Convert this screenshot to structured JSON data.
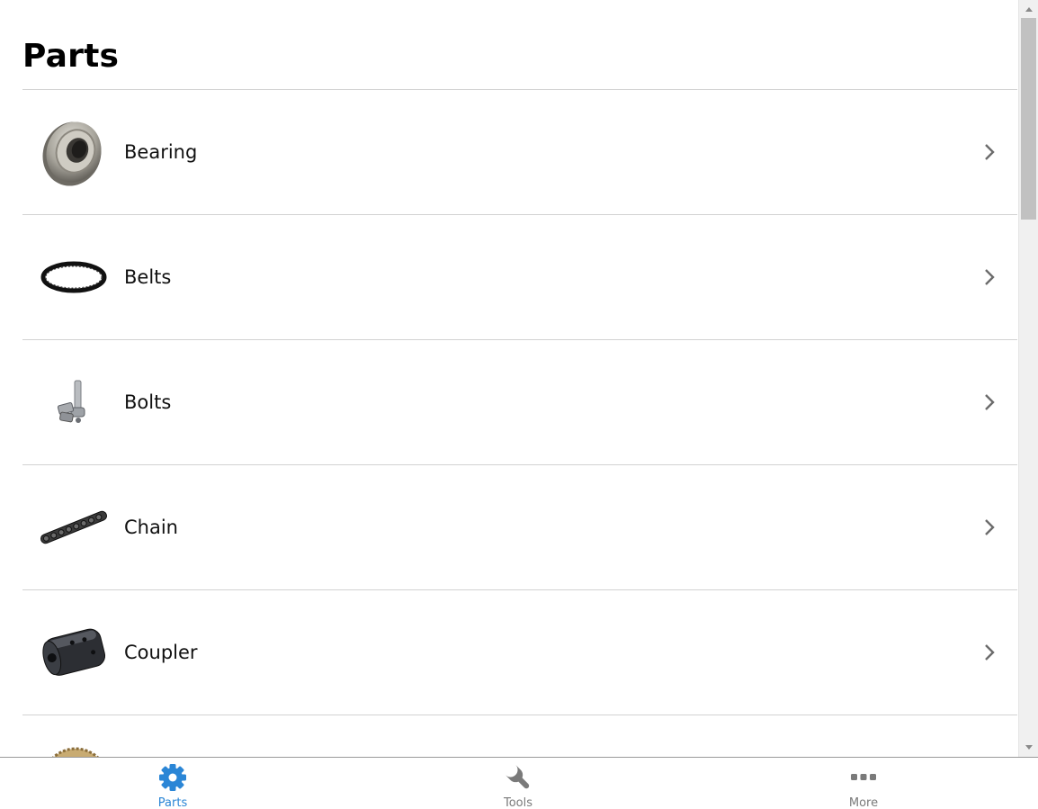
{
  "page": {
    "title": "Parts"
  },
  "parts": [
    {
      "label": "Bearing",
      "image": "bearing-image"
    },
    {
      "label": "Belts",
      "image": "belt-image"
    },
    {
      "label": "Bolts",
      "image": "bolts-image"
    },
    {
      "label": "Chain",
      "image": "chain-image"
    },
    {
      "label": "Coupler",
      "image": "coupler-image"
    },
    {
      "label": "",
      "image": "gear-image"
    }
  ],
  "tabs": [
    {
      "label": "Parts",
      "icon": "gear-icon",
      "active": true
    },
    {
      "label": "Tools",
      "icon": "wrench-icon",
      "active": false
    },
    {
      "label": "More",
      "icon": "more-dots-icon",
      "active": false
    }
  ],
  "colors": {
    "accent": "#2b86d6",
    "inactive": "#7a7a7a",
    "divider": "#d2d2d2"
  }
}
